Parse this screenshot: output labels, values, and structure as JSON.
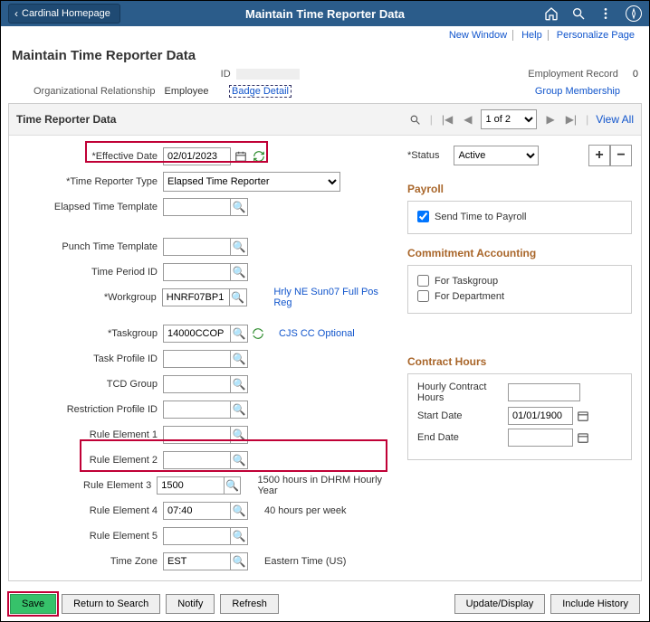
{
  "topbar": {
    "back": "Cardinal Homepage",
    "title": "Maintain Time Reporter Data"
  },
  "sublinks": {
    "new_window": "New Window",
    "help": "Help",
    "personalize": "Personalize Page"
  },
  "page_title": "Maintain Time Reporter Data",
  "header": {
    "id_label": "ID",
    "emp_record_label": "Employment Record",
    "emp_record_value": "0",
    "org_rel_label": "Organizational Relationship",
    "org_rel_value": "Employee",
    "badge_link": "Badge Detail",
    "group_link": "Group Membership"
  },
  "panel": {
    "title": "Time Reporter Data",
    "pager": "1 of 2",
    "view_all": "View All"
  },
  "form": {
    "eff_date_label": "Effective Date",
    "eff_date_value": "02/01/2023",
    "status_label": "Status",
    "status_value": "Active",
    "reporter_type_label": "Time Reporter Type",
    "reporter_type_value": "Elapsed Time Reporter",
    "elapsed_tmpl_label": "Elapsed Time Template",
    "punch_tmpl_label": "Punch Time Template",
    "time_period_label": "Time Period ID",
    "workgroup_label": "Workgroup",
    "workgroup_value": "HNRF07BP1",
    "workgroup_desc": "Hrly NE Sun07 Full Pos Reg",
    "taskgroup_label": "Taskgroup",
    "taskgroup_value": "14000CCOP",
    "taskgroup_desc": "CJS CC Optional",
    "task_profile_label": "Task Profile ID",
    "tcd_group_label": "TCD Group",
    "restriction_label": "Restriction Profile ID",
    "rule1_label": "Rule Element 1",
    "rule2_label": "Rule Element 2",
    "rule3_label": "Rule Element 3",
    "rule3_value": "1500",
    "rule3_desc": "1500 hours in DHRM Hourly Year",
    "rule4_label": "Rule Element 4",
    "rule4_value": "07:40",
    "rule4_desc": "40 hours per week",
    "rule5_label": "Rule Element 5",
    "timezone_label": "Time Zone",
    "timezone_value": "EST",
    "timezone_desc": "Eastern Time (US)"
  },
  "payroll": {
    "title": "Payroll",
    "send": "Send Time to Payroll"
  },
  "commit": {
    "title": "Commitment Accounting",
    "taskgroup": "For Taskgroup",
    "department": "For Department"
  },
  "contract": {
    "title": "Contract Hours",
    "hourly_label": "Hourly Contract Hours",
    "start_label": "Start Date",
    "start_value": "01/01/1900",
    "end_label": "End Date"
  },
  "footer": {
    "save": "Save",
    "return": "Return to Search",
    "notify": "Notify",
    "refresh": "Refresh",
    "update": "Update/Display",
    "history": "Include History"
  }
}
